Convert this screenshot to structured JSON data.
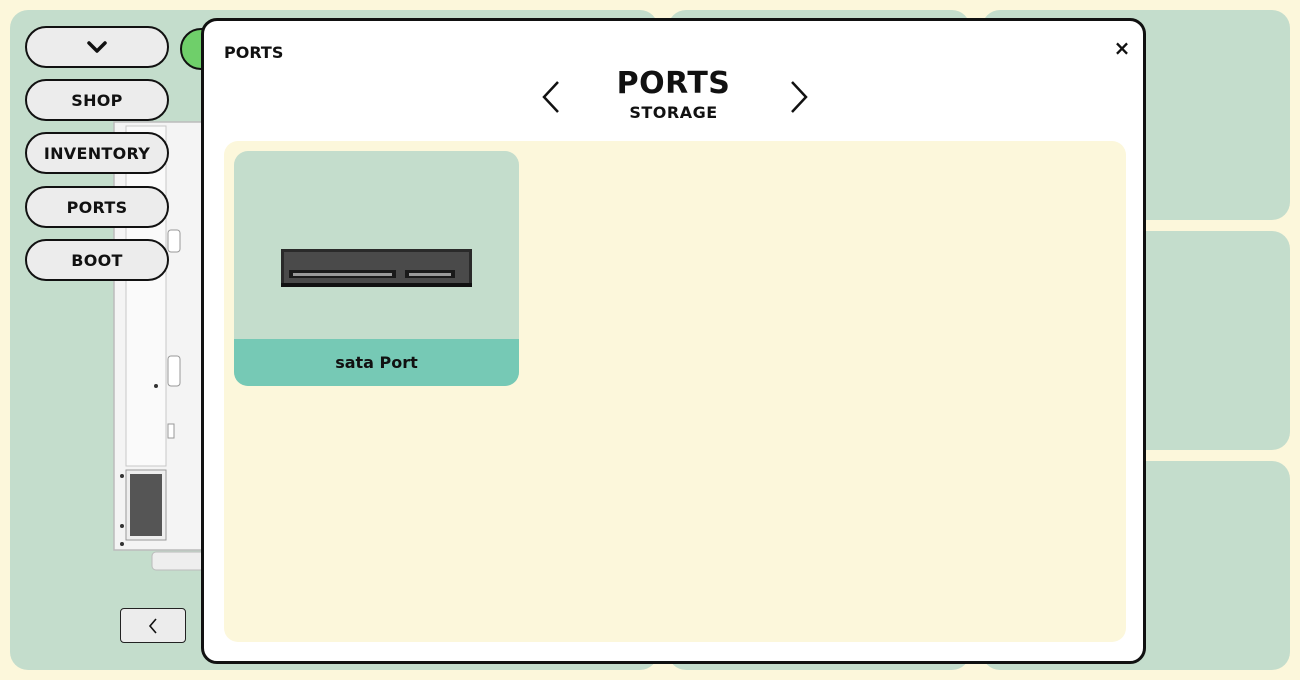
{
  "sidebar": {
    "dropdown_icon": "chevron-down-icon",
    "items": [
      {
        "label": "SHOP"
      },
      {
        "label": "INVENTORY"
      },
      {
        "label": "PORTS"
      },
      {
        "label": "BOOT"
      }
    ]
  },
  "modal": {
    "label": "PORTS",
    "close": "×",
    "title": "PORTS",
    "subtitle": "STORAGE",
    "items": [
      {
        "name": "sata Port",
        "icon": "sata-port-image"
      }
    ]
  },
  "colors": {
    "background": "#fcf7db",
    "panel": "#c4ddcc",
    "card_label": "#76c9b5",
    "accent_green": "#6fcf6a"
  }
}
